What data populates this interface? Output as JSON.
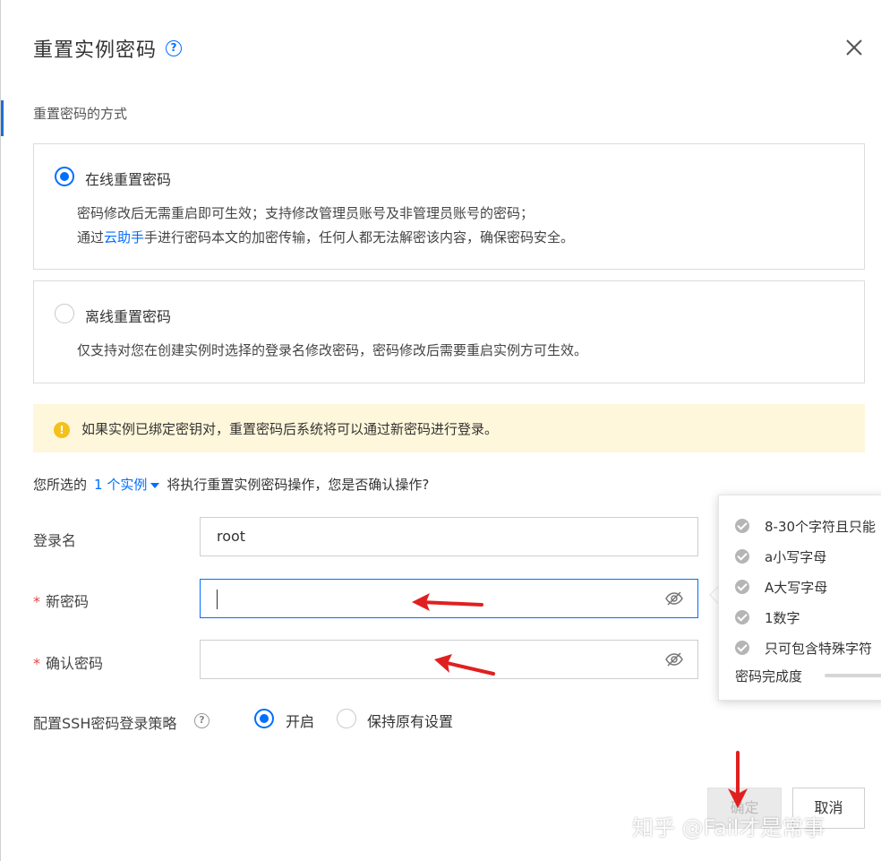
{
  "dialog": {
    "title": "重置实例密码",
    "help_glyph": "?",
    "section_label": "重置密码的方式"
  },
  "options": [
    {
      "title": "在线重置密码",
      "selected": true,
      "desc_line1": "密码修改后无需重启即可生效；支持修改管理员账号及非管理员账号的密码；",
      "desc_line2_prefix": "通过",
      "desc_line2_link": "云助手",
      "desc_line2_suffix": "手进行密码本文的加密传输，任何人都无法解密该内容，确保密码安全。"
    },
    {
      "title": "离线重置密码",
      "selected": false,
      "desc_line1": "仅支持对您在创建实例时选择的登录名修改密码，密码修改后需要重启实例方可生效。"
    }
  ],
  "warning": {
    "icon_glyph": "!",
    "text": "如果实例已绑定密钥对，重置密码后系统将可以通过新密码进行登录。"
  },
  "confirm": {
    "prefix": "您所选的",
    "instances": "1 个实例",
    "suffix": "将执行重置实例密码操作，您是否确认操作?"
  },
  "form": {
    "login_label": "登录名",
    "login_value": "root",
    "required_mark": "*",
    "new_pwd_label": "新密码",
    "confirm_pwd_label": "确认密码",
    "ssh_label": "配置SSH密码登录策略",
    "ssh_help_glyph": "?",
    "ssh_on": "开启",
    "ssh_keep": "保持原有设置"
  },
  "popover": {
    "rules": [
      "8-30个字符且只能",
      "a小写字母",
      "A大写字母",
      "1数字",
      "只可包含特殊字符"
    ],
    "strength_label": "密码完成度",
    "strength_fraction": 0
  },
  "buttons": {
    "ok": "确定",
    "cancel": "取消"
  },
  "watermark": "知乎 @Fail才是常事",
  "colors": {
    "primary": "#006eff",
    "warning_bg": "#fff7db",
    "annotation_red": "#e02020"
  }
}
